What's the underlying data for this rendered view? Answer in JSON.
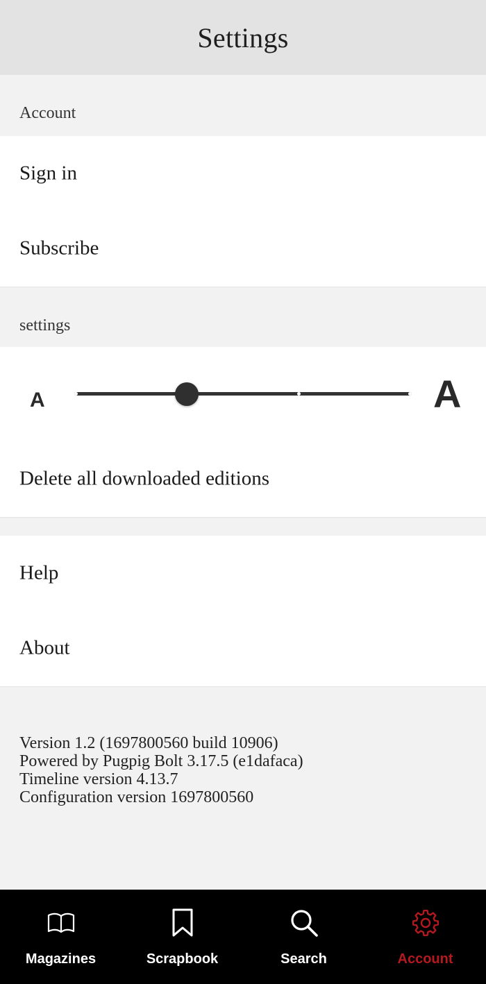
{
  "header": {
    "title": "Settings"
  },
  "account_section": {
    "heading": "Account",
    "items": [
      {
        "label": "Sign in"
      },
      {
        "label": "Subscribe"
      }
    ]
  },
  "settings_section": {
    "heading": "settings",
    "text_size_slider": {
      "small_label": "A",
      "large_label": "A",
      "stops": 4,
      "selected_index": 1
    },
    "items": [
      {
        "label": "Delete all downloaded editions"
      }
    ]
  },
  "support_section": {
    "items": [
      {
        "label": "Help"
      },
      {
        "label": "About"
      }
    ]
  },
  "version_info": {
    "lines": [
      "Version 1.2 (1697800560 build 10906)",
      "Powered by Pugpig Bolt 3.17.5 (e1dafaca)",
      "Timeline version 4.13.7",
      "Configuration version 1697800560"
    ]
  },
  "bottom_nav": {
    "active_color": "#b3191f",
    "inactive_color": "#ffffff",
    "items": [
      {
        "label": "Magazines",
        "icon": "open-book-icon",
        "active": false
      },
      {
        "label": "Scrapbook",
        "icon": "bookmark-icon",
        "active": false
      },
      {
        "label": "Search",
        "icon": "search-icon",
        "active": false
      },
      {
        "label": "Account",
        "icon": "gear-icon",
        "active": true
      }
    ]
  }
}
